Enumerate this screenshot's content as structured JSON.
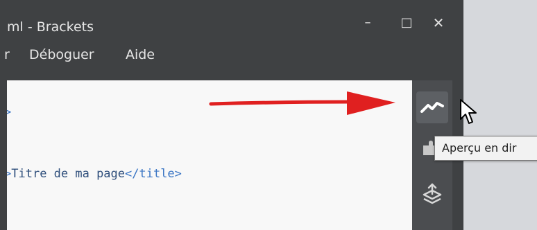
{
  "window": {
    "title": "ml - Brackets",
    "controls": {
      "minimize": "–",
      "maximize": "□",
      "close": "✕"
    }
  },
  "menu": {
    "items": [
      "r",
      "Déboguer",
      "Aide"
    ]
  },
  "editor": {
    "lines": [
      {
        "prefix": ">",
        "text": "",
        "tag": ""
      },
      {
        "prefix": ">",
        "text": "Titre de ma page",
        "tag": "</title>"
      },
      {
        "prefix": "",
        "text": "",
        "tag": ""
      }
    ]
  },
  "toolbar": {
    "buttons": [
      {
        "icon": "live-preview-icon"
      },
      {
        "icon": "extension-manager-icon"
      },
      {
        "icon": "layers-icon"
      }
    ],
    "tooltip": "Aperçu en dir"
  },
  "colors": {
    "arrow": "#e02020",
    "window_bg": "#3f4143",
    "editor_bg": "#f8f8f8",
    "tag": "#3a75c4"
  }
}
